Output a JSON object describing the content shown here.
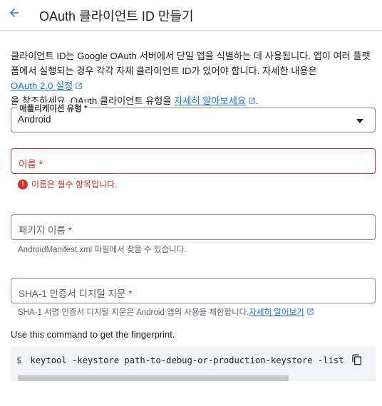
{
  "header": {
    "title": "OAuth 클라이언트 ID 만들기",
    "back_icon": "arrow-back-icon"
  },
  "intro": {
    "part1": "클라이언트 ID는 Google OAuth 서버에서 단일 앱을 식별하는 데 사용됩니다. 앱이 여러 플랫폼에서 실행되는 경우 각각 자체 클라이언트 ID가 있어야 합니다. 자세한 내용은 ",
    "link1": "OAuth 2.0 설정",
    "part2": "을 참조하세요. OAuth 클라이언트 유형을 ",
    "link2": "자세히 알아보세요",
    "part3": "."
  },
  "app_type": {
    "label": "애플리케이션 유형 *",
    "value": "Android"
  },
  "name_field": {
    "placeholder": "이름",
    "required_mark": "*",
    "error": "이름은 필수 항목입니다."
  },
  "package_field": {
    "placeholder": "패키지 이름",
    "required_mark": "*",
    "helper": "AndroidManifest.xml 파일에서 찾을 수 있습니다."
  },
  "sha1_field": {
    "placeholder": "SHA-1 인증서 디지털 지문",
    "required_mark": "*",
    "helper": "SHA-1 서명 인증서 디지털 지문은 Android 앱의 사용을 제한합니다.",
    "helper_link": "자세히 알아보기"
  },
  "command": {
    "intro": "Use this command to get the fingerprint.",
    "prompt": "$",
    "text": "keytool -keystore path-to-debug-or-production-keystore -list"
  },
  "colors": {
    "accent": "#1a73e8",
    "error": "#d93025",
    "code_bg": "#f1f3f4"
  }
}
